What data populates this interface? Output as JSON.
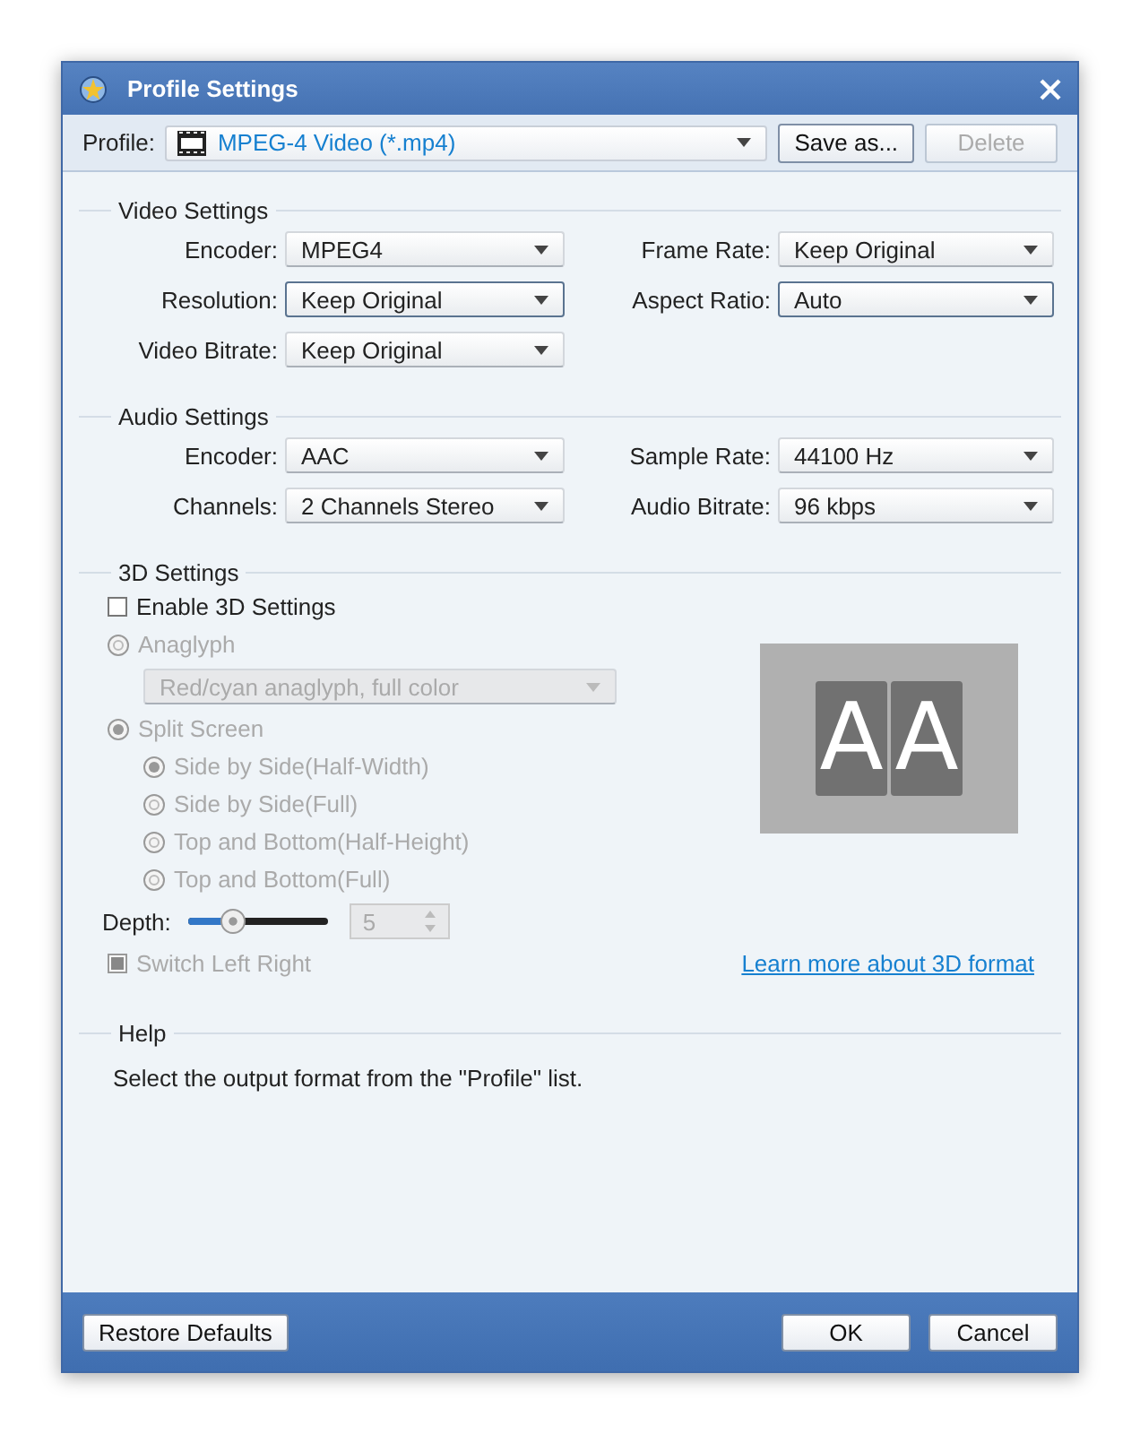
{
  "window": {
    "title": "Profile Settings"
  },
  "profile": {
    "label": "Profile:",
    "value": "MPEG-4 Video (*.mp4)",
    "buttons": [
      {
        "label": "Save as...",
        "disabled": false
      },
      {
        "label": "Delete",
        "disabled": true
      }
    ]
  },
  "video_settings": {
    "title": "Video Settings",
    "rows": [
      [
        {
          "label": "Encoder:",
          "value": "MPEG4",
          "focused": false
        },
        {
          "label": "Frame Rate:",
          "value": "Keep Original",
          "focused": false
        }
      ],
      [
        {
          "label": "Resolution:",
          "value": "Keep Original",
          "focused": true
        },
        {
          "label": "Aspect Ratio:",
          "value": "Auto",
          "focused": true
        }
      ],
      [
        {
          "label": "Video Bitrate:",
          "value": "Keep Original",
          "focused": false
        }
      ]
    ]
  },
  "audio_settings": {
    "title": "Audio Settings",
    "rows": [
      [
        {
          "label": "Encoder:",
          "value": "AAC",
          "focused": false
        },
        {
          "label": "Sample Rate:",
          "value": "44100 Hz",
          "focused": false
        }
      ],
      [
        {
          "label": "Channels:",
          "value": "2 Channels Stereo",
          "focused": false
        },
        {
          "label": "Audio Bitrate:",
          "value": "96 kbps",
          "focused": false
        }
      ]
    ]
  },
  "settings_3d": {
    "title": "3D Settings",
    "enable": {
      "label": "Enable 3D Settings",
      "checked": false
    },
    "anaglyph": {
      "label": "Anaglyph",
      "selected": false,
      "disabled": true,
      "dropdown": "Red/cyan anaglyph, full color"
    },
    "split_screen": {
      "label": "Split Screen",
      "selected": true,
      "disabled": true,
      "options": [
        {
          "label": "Side by Side(Half-Width)",
          "selected": true
        },
        {
          "label": "Side by Side(Full)",
          "selected": false
        },
        {
          "label": "Top and Bottom(Half-Height)",
          "selected": false
        },
        {
          "label": "Top and Bottom(Full)",
          "selected": false
        }
      ]
    },
    "depth": {
      "label": "Depth:",
      "level": 0.28,
      "value": "5",
      "disabled": true
    },
    "switch_left_right": {
      "label": "Switch Left Right",
      "checked": true,
      "disabled": true
    },
    "preview": {
      "letters": [
        "A",
        "A"
      ]
    },
    "link": "Learn more about 3D format"
  },
  "help": {
    "title": "Help",
    "text": "Select the output format from the \"Profile\" list."
  },
  "footer": {
    "left_button": "Restore Defaults",
    "right_buttons": [
      "OK",
      "Cancel"
    ]
  }
}
